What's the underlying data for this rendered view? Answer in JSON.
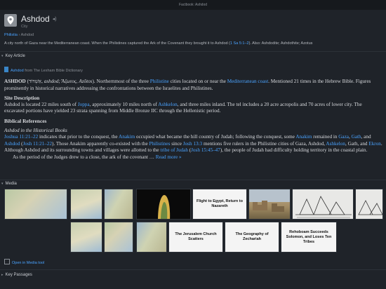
{
  "window": {
    "title": "Factbook: Ashdod"
  },
  "header": {
    "title": "Ashdod",
    "subtitle": "City",
    "speaker_icon": "speaker-icon"
  },
  "breadcrumb": {
    "parent": "Philistia",
    "separator": "›",
    "current": "Ashdod"
  },
  "description": {
    "text": "A city north of Gaza near the Mediterranean coast. When the Philistines captured the Ark of the Covenant they brought it to Ashdod (",
    "ref": "1 Sa 5:1–2",
    "rest": "). Also: Ashdodite; Ashdothite; Azotus"
  },
  "key_article": {
    "header": "Key Article",
    "source_link": "Ashdod",
    "source_rest": "from The Lexham Bible Dictionary"
  },
  "article": {
    "p1_a": "ASHDOD",
    "p1_b": " (אַשְׁדּוֹד, ",
    "p1_c": "ashdod; Ἄζωτος, Azōtos",
    "p1_d": "). Northernmost of the three ",
    "p1_link1": "Philistine",
    "p1_e": " cities located on or near the ",
    "p1_link2": "Mediterranean coast",
    "p1_f": ". Mentioned 21 times in the Hebrew Bible. Figures prominently in historical narratives addressing the confrontations between the Israelites and Philistines.",
    "h_site": "Site Description",
    "p2_a": "Ashdod is located 22 miles south of ",
    "p2_link1": "Joppa",
    "p2_b": ", approximately 10 miles north of ",
    "p2_link2": "Ashkelon",
    "p2_c": ", and three miles inland. The tel includes a 20 acre acropolis and 70 acres of lower city. The excavated portions have yielded 23 strata spanning from Middle Bronze IIC through the Hellenistic period.",
    "h_bib": "Biblical References",
    "sub_it": "Ashdod in the Historical Books",
    "p3_link1": "Joshua 11:21–22",
    "p3_a": " indicates that prior to the conquest, the ",
    "p3_link2": "Anakim",
    "p3_b": " occupied what became the hill country of Judah; following the conquest, some ",
    "p3_link3": "Anakim",
    "p3_c": " remained in ",
    "p3_link4": "Gaza",
    "p3_d": ", ",
    "p3_link5": "Gath",
    "p3_e": ", and ",
    "p3_link6": "Ashdod",
    "p3_f": " (",
    "p3_link7": "Josh 11:21–22",
    "p3_g": "). Those Anakim apparently co-existed with the ",
    "p3_link8": "Philistines",
    "p3_h": " since ",
    "p3_link9": "Josh 13:3",
    "p3_i": " mentions five rulers in the Philistine cities of Gaza, Ashdod, ",
    "p3_link10": "Ashkelon",
    "p3_j": ", Gath, and ",
    "p3_link11": "Ekron",
    "p3_k": ". Although Ashdod and its surrounding towns and villages were allotted to the ",
    "p3_link12": "tribe of Judah",
    "p3_l": " (",
    "p3_link13": "Josh 15:45–47",
    "p3_m": "), the people of Judah had difficulty holding territory in the coastal plain.",
    "p4": "As the period of the Judges drew to a close, the ark of the covenant … ",
    "read_more": "Read more »"
  },
  "media": {
    "header": "Media",
    "thumb_fig1": "Flight to Egypt, Return to Nazareth",
    "thumb_fig2": "The Jerusalem Church Scatters",
    "thumb_fig3": "The Geography of Zechariah",
    "thumb_fig4": "Rehoboam Succeeds Solomon, and Loses Ten Tribes",
    "open_link": "Open in Media tool"
  },
  "key_passages": {
    "header": "Key Passages"
  }
}
